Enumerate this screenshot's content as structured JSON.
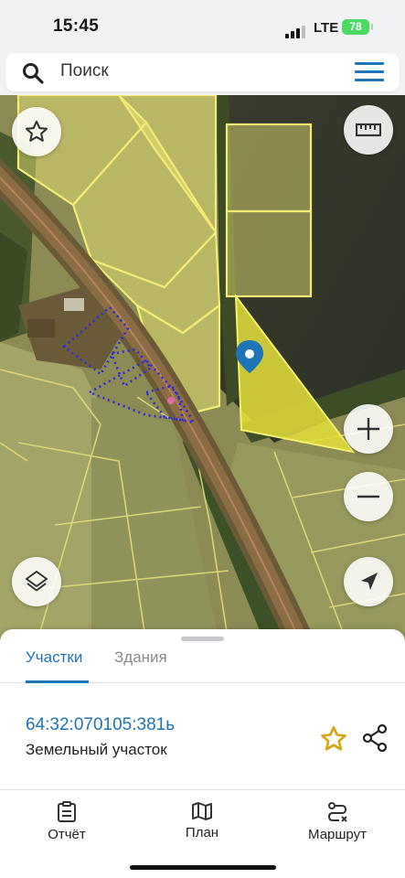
{
  "status_bar": {
    "time": "15:45",
    "network": "LTE",
    "battery": "78"
  },
  "search": {
    "placeholder": "Поиск"
  },
  "sheet": {
    "tabs": [
      {
        "label": "Участки"
      },
      {
        "label": "Здания"
      }
    ],
    "parcel": {
      "cadastral_number": "64:32:070105:381ь",
      "type": "Земельный участок"
    }
  },
  "nav": [
    {
      "label": "Отчёт"
    },
    {
      "label": "План"
    },
    {
      "label": "Маршрут"
    }
  ],
  "colors": {
    "accent": "#1f73b7",
    "parcel_fill": "#e4df3a",
    "star": "#d4a514"
  },
  "icons": [
    "search-icon",
    "menu-icon",
    "star-icon",
    "ruler-icon",
    "zoom-in-icon",
    "zoom-out-icon",
    "layers-icon",
    "location-arrow-icon",
    "map-pin-icon",
    "share-icon",
    "report-icon",
    "map-plan-icon",
    "route-icon"
  ]
}
